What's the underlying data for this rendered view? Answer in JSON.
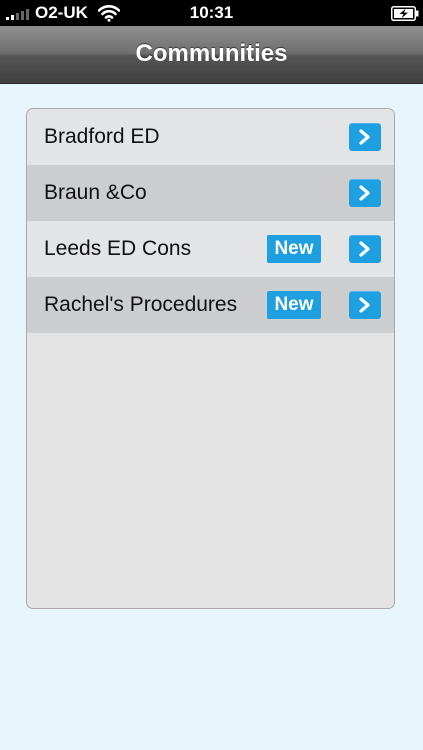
{
  "status_bar": {
    "carrier": "O2-UK",
    "time": "10:31",
    "signal_icon": "signal-bars-icon",
    "wifi_icon": "wifi-icon",
    "battery_icon": "battery-charging-icon"
  },
  "nav": {
    "title": "Communities"
  },
  "list": {
    "items": [
      {
        "label": "Bradford ED",
        "badge": ""
      },
      {
        "label": "Braun &Co",
        "badge": ""
      },
      {
        "label": "Leeds ED Cons",
        "badge": "New"
      },
      {
        "label": "Rachel's Procedures",
        "badge": "New"
      }
    ],
    "disclosure_icon": "chevron-right-icon"
  },
  "colors": {
    "accent": "#1e9fe0",
    "background": "#e8f4fb",
    "nav_bar": "#5a5a5a",
    "row_light": "#e3e4e6",
    "row_dark": "#cccdcf"
  }
}
